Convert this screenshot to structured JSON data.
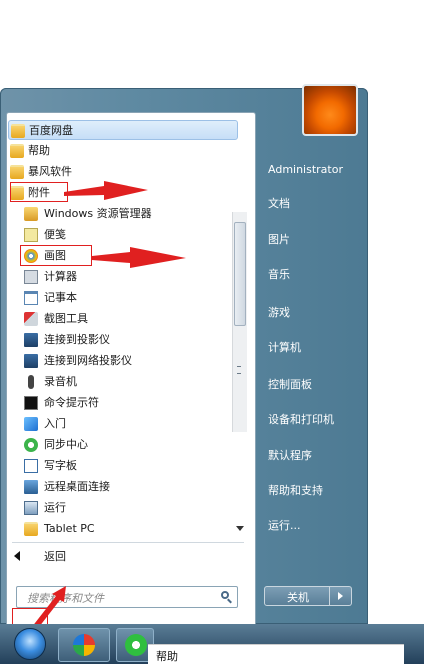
{
  "user": {
    "name": "Administrator"
  },
  "left_menu": {
    "items": [
      {
        "label": "百度网盘",
        "icon": "folder-icon"
      },
      {
        "label": "帮助",
        "icon": "folder-icon"
      },
      {
        "label": "暴风软件",
        "icon": "folder-icon"
      },
      {
        "label": "附件",
        "icon": "folder-open-icon"
      }
    ],
    "sub_items": [
      {
        "label": "Windows 资源管理器",
        "icon": "explorer-icon"
      },
      {
        "label": "便笺",
        "icon": "sticky-notes-icon"
      },
      {
        "label": "画图",
        "icon": "paint-icon"
      },
      {
        "label": "计算器",
        "icon": "calculator-icon"
      },
      {
        "label": "记事本",
        "icon": "notepad-icon"
      },
      {
        "label": "截图工具",
        "icon": "snipping-tool-icon"
      },
      {
        "label": "连接到投影仪",
        "icon": "projector-icon"
      },
      {
        "label": "连接到网络投影仪",
        "icon": "network-projector-icon"
      },
      {
        "label": "录音机",
        "icon": "microphone-icon"
      },
      {
        "label": "命令提示符",
        "icon": "cmd-icon"
      },
      {
        "label": "入门",
        "icon": "getting-started-icon"
      },
      {
        "label": "同步中心",
        "icon": "sync-icon"
      },
      {
        "label": "写字板",
        "icon": "wordpad-icon"
      },
      {
        "label": "远程桌面连接",
        "icon": "remote-desktop-icon"
      },
      {
        "label": "运行",
        "icon": "run-icon"
      },
      {
        "label": "Tablet PC",
        "icon": "folder-icon"
      }
    ],
    "back_label": "返回"
  },
  "search": {
    "placeholder": "搜索程序和文件"
  },
  "right_menu": {
    "items": [
      "文档",
      "图片",
      "音乐",
      "游戏",
      "计算机",
      "控制面板",
      "设备和打印机",
      "默认程序",
      "帮助和支持",
      "运行..."
    ]
  },
  "shutdown": {
    "label": "关机"
  },
  "taskbar": {
    "tooltip": "帮助"
  },
  "colors": {
    "annotation_red": "#e02020",
    "start_menu_blue": "#5f8aa2"
  }
}
